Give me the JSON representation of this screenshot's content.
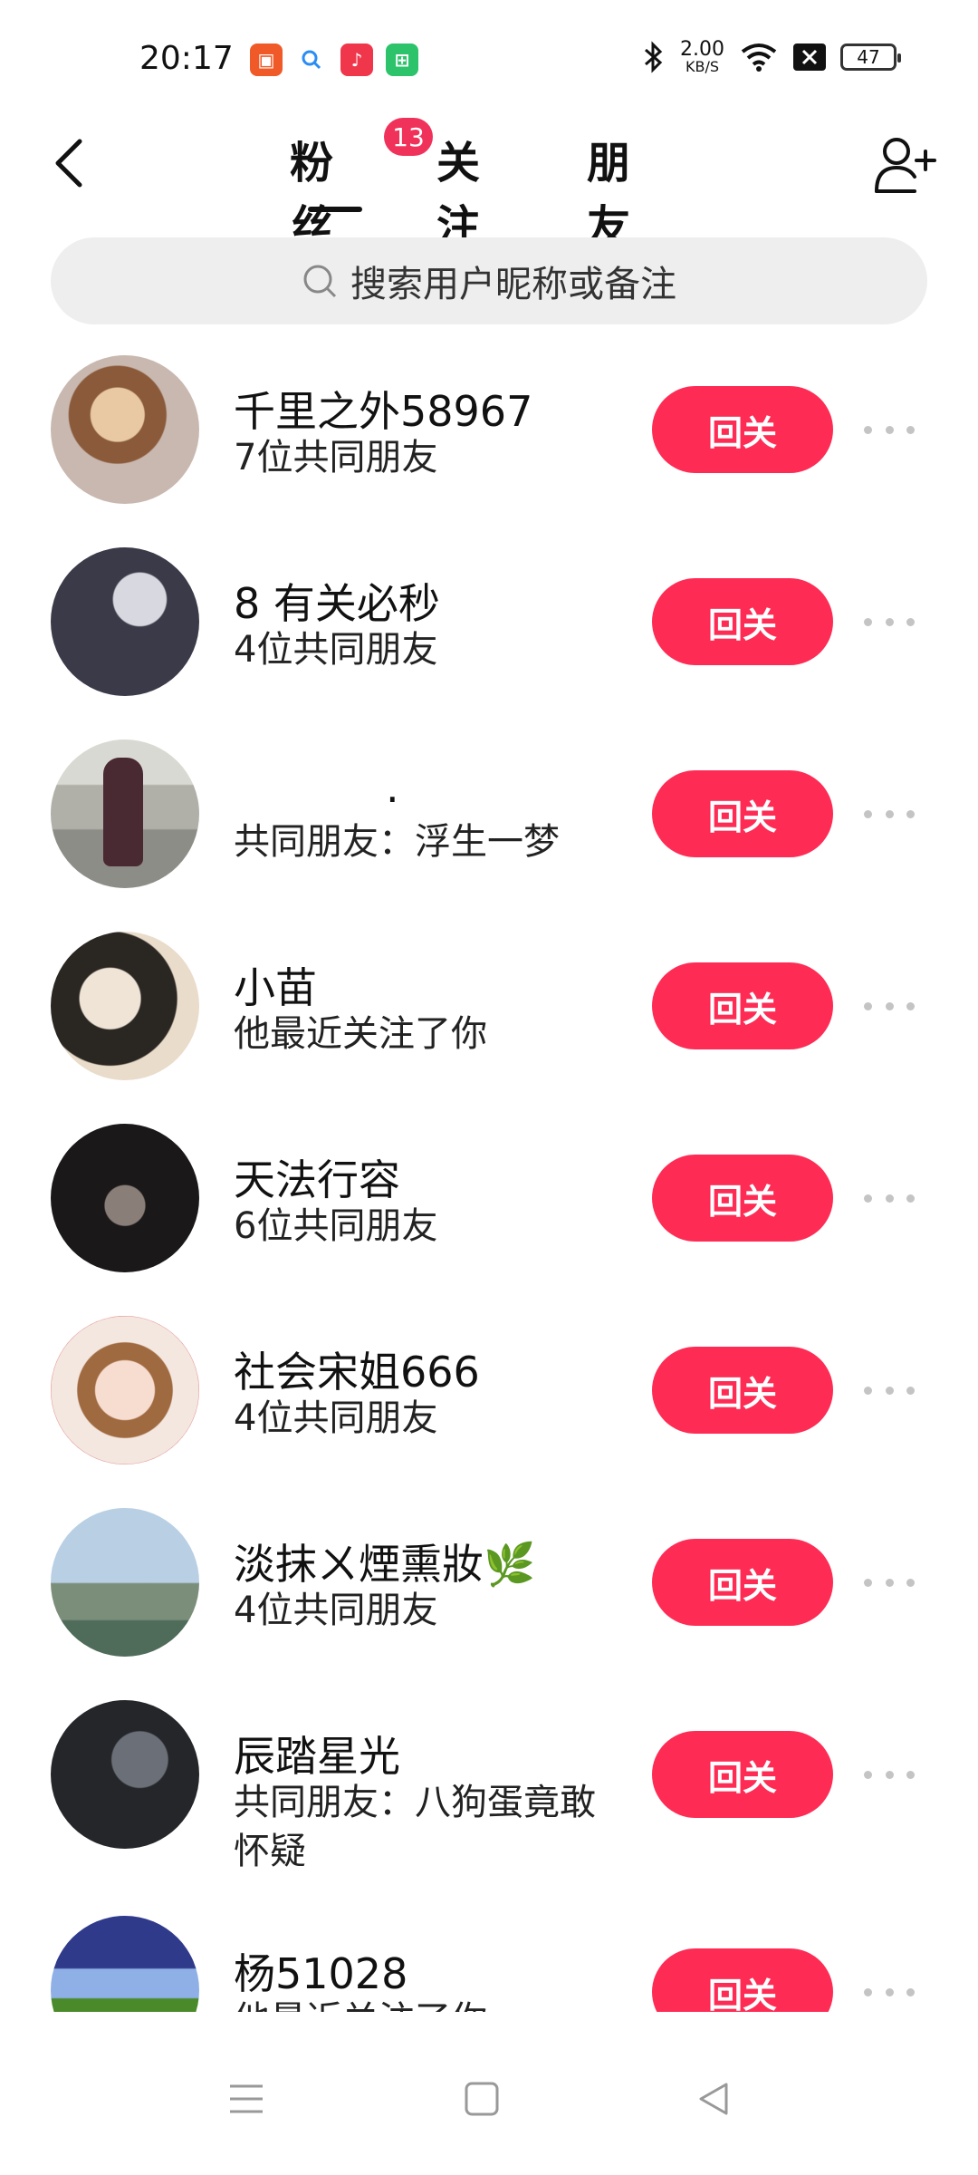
{
  "status_bar": {
    "time": "20:17",
    "net_speed_value": "2.00",
    "net_speed_unit": "KB/S",
    "battery": "47",
    "icons": [
      "bluetooth-icon",
      "wifi-icon",
      "x-box-icon"
    ]
  },
  "header": {
    "tabs": [
      {
        "label": "粉丝",
        "active": true
      },
      {
        "label": "关注",
        "active": false
      },
      {
        "label": "朋友",
        "active": false
      }
    ],
    "badge": "13"
  },
  "search": {
    "placeholder": "搜索用户昵称或备注"
  },
  "users": [
    {
      "name": "千里之外58967",
      "sub": "7位共同朋友",
      "button": "回关"
    },
    {
      "name": "8 有关必秒",
      "sub": "4位共同朋友",
      "button": "回关"
    },
    {
      "name": ".",
      "sub": "共同朋友：浮生一梦",
      "button": "回关"
    },
    {
      "name": "小苗",
      "sub": "他最近关注了你",
      "button": "回关"
    },
    {
      "name": "天法行容",
      "sub": "6位共同朋友",
      "button": "回关"
    },
    {
      "name": "社会宋姐666",
      "sub": "4位共同朋友",
      "button": "回关"
    },
    {
      "name": "淡抹ㄨ煙熏妝🌿",
      "sub": "4位共同朋友",
      "button": "回关"
    },
    {
      "name": "辰踏星光",
      "sub": "共同朋友：八狗蛋竟敢怀疑",
      "button": "回关"
    },
    {
      "name": "杨51028",
      "sub": "他最近关注了你",
      "button": "回关"
    }
  ],
  "colors": {
    "accent": "#fe2c55",
    "badge": "#f0325a"
  }
}
